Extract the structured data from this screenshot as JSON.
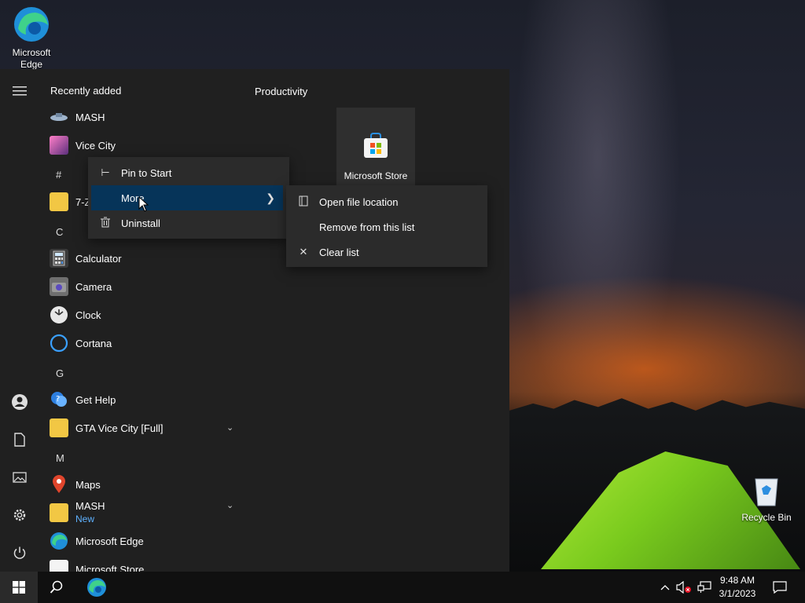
{
  "desktop": {
    "edge_label": "Microsoft Edge",
    "recycle_label": "Recycle Bin"
  },
  "start_menu": {
    "recently_added_title": "Recently added",
    "productivity_title": "Productivity",
    "tile_store_label": "Microsoft Store",
    "apps": {
      "mash_recent": "MASH",
      "vice_city": "Vice City",
      "hash_letter": "#",
      "seven_zip": "7-Zip",
      "c_letter": "C",
      "calculator": "Calculator",
      "camera": "Camera",
      "clock": "Clock",
      "cortana": "Cortana",
      "g_letter": "G",
      "get_help": "Get Help",
      "gta_folder": "GTA Vice City [Full]",
      "m_letter": "M",
      "maps": "Maps",
      "mash_folder": "MASH",
      "mash_new": "New",
      "edge": "Microsoft Edge",
      "store": "Microsoft Store"
    }
  },
  "context_menu": {
    "pin_to_start": "Pin to Start",
    "more": "More",
    "uninstall": "Uninstall"
  },
  "submenu": {
    "open_file_location": "Open file location",
    "remove_from_list": "Remove from this list",
    "clear_list": "Clear list"
  },
  "taskbar": {
    "time": "9:48 AM",
    "date": "3/1/2023"
  },
  "colors": {
    "accent_highlight": "#063459",
    "menu_bg": "#202020",
    "new_badge": "#5fb2ff"
  }
}
